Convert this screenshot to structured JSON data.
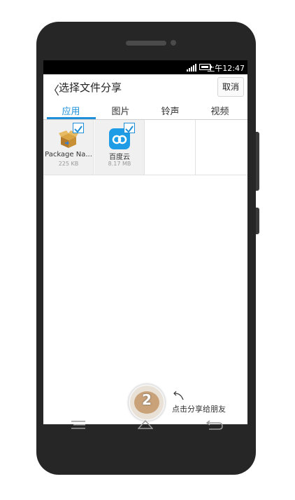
{
  "status_bar": {
    "time": "上午12:47"
  },
  "header": {
    "back_glyph": "〈",
    "title": "选择文件分享",
    "cancel_label": "取消"
  },
  "tabs": [
    {
      "label": "应用",
      "active": true
    },
    {
      "label": "图片",
      "active": false
    },
    {
      "label": "铃声",
      "active": false
    },
    {
      "label": "视频",
      "active": false
    }
  ],
  "apps": [
    {
      "name": "Package Na...",
      "size": "225 KB",
      "icon": "package-installer-icon",
      "checked": true
    },
    {
      "name": "百度云",
      "size": "8.17 MB",
      "icon": "baidu-cloud-icon",
      "checked": true
    }
  ],
  "share_bubble": {
    "count": "2"
  },
  "hint": {
    "text": "点击分享给朋友"
  },
  "colors": {
    "accent": "#1e8fd8",
    "phone_body": "#262626"
  }
}
